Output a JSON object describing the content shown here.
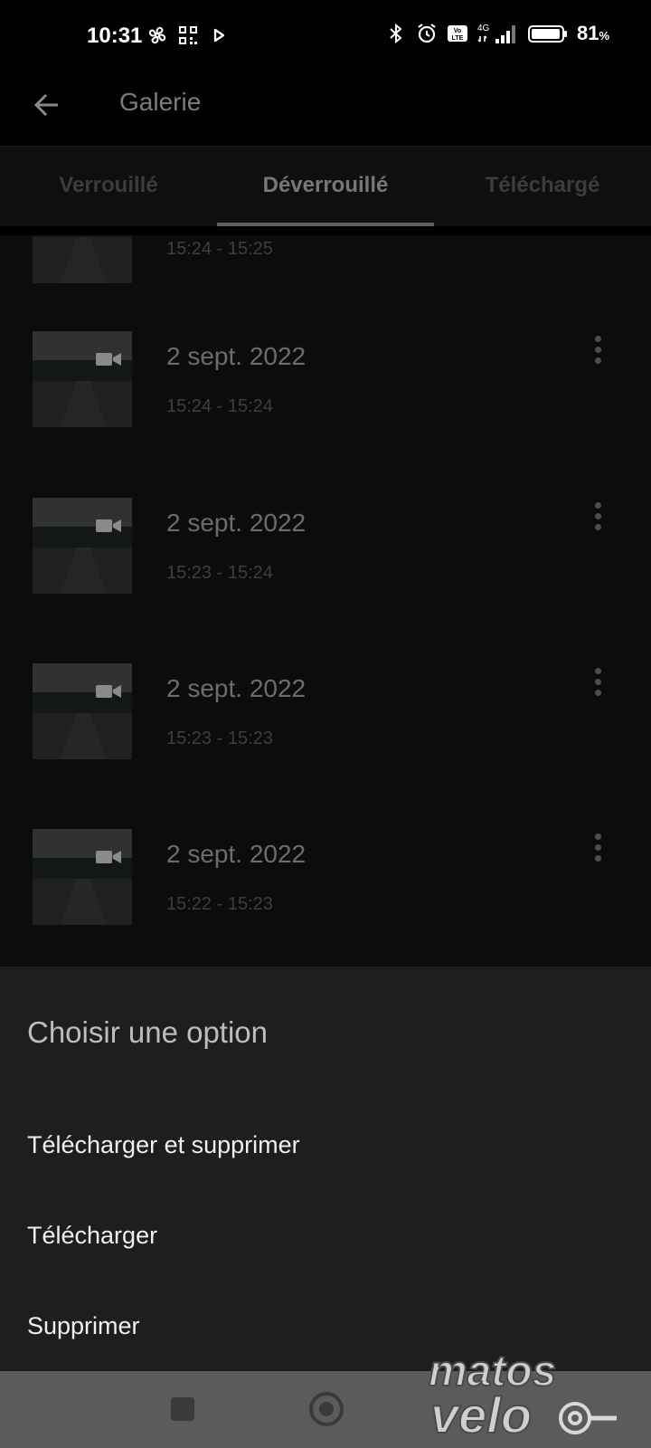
{
  "status_bar": {
    "time": "10:31",
    "battery_percent": "81",
    "battery_unit": "%",
    "network_label": "4G",
    "icons_left": [
      "fan-icon",
      "qr-code-icon",
      "play-icon"
    ],
    "icons_right": [
      "bluetooth-icon",
      "alarm-icon",
      "volte-icon",
      "signal-icon",
      "battery-icon"
    ]
  },
  "app_bar": {
    "title": "Galerie"
  },
  "tabs": [
    {
      "label": "Verrouillé",
      "active": false
    },
    {
      "label": "Déverrouillé",
      "active": true
    },
    {
      "label": "Téléchargé",
      "active": false
    }
  ],
  "list": {
    "items": [
      {
        "date": "",
        "time": "15:24 - 15:25"
      },
      {
        "date": "2 sept. 2022",
        "time": "15:24 - 15:24"
      },
      {
        "date": "2 sept. 2022",
        "time": "15:23 - 15:24"
      },
      {
        "date": "2 sept. 2022",
        "time": "15:23 - 15:23"
      },
      {
        "date": "2 sept. 2022",
        "time": "15:22 - 15:23"
      }
    ]
  },
  "sheet": {
    "title": "Choisir une option",
    "options": [
      "Télécharger et supprimer",
      "Télécharger",
      "Supprimer"
    ]
  },
  "watermark": {
    "line1": "matos",
    "line2": "velo"
  },
  "colors": {
    "background": "#000000",
    "sheet": "#1e1e1e",
    "nav_bar": "#5b5b5b",
    "dim_text": "#6c6c6c"
  }
}
